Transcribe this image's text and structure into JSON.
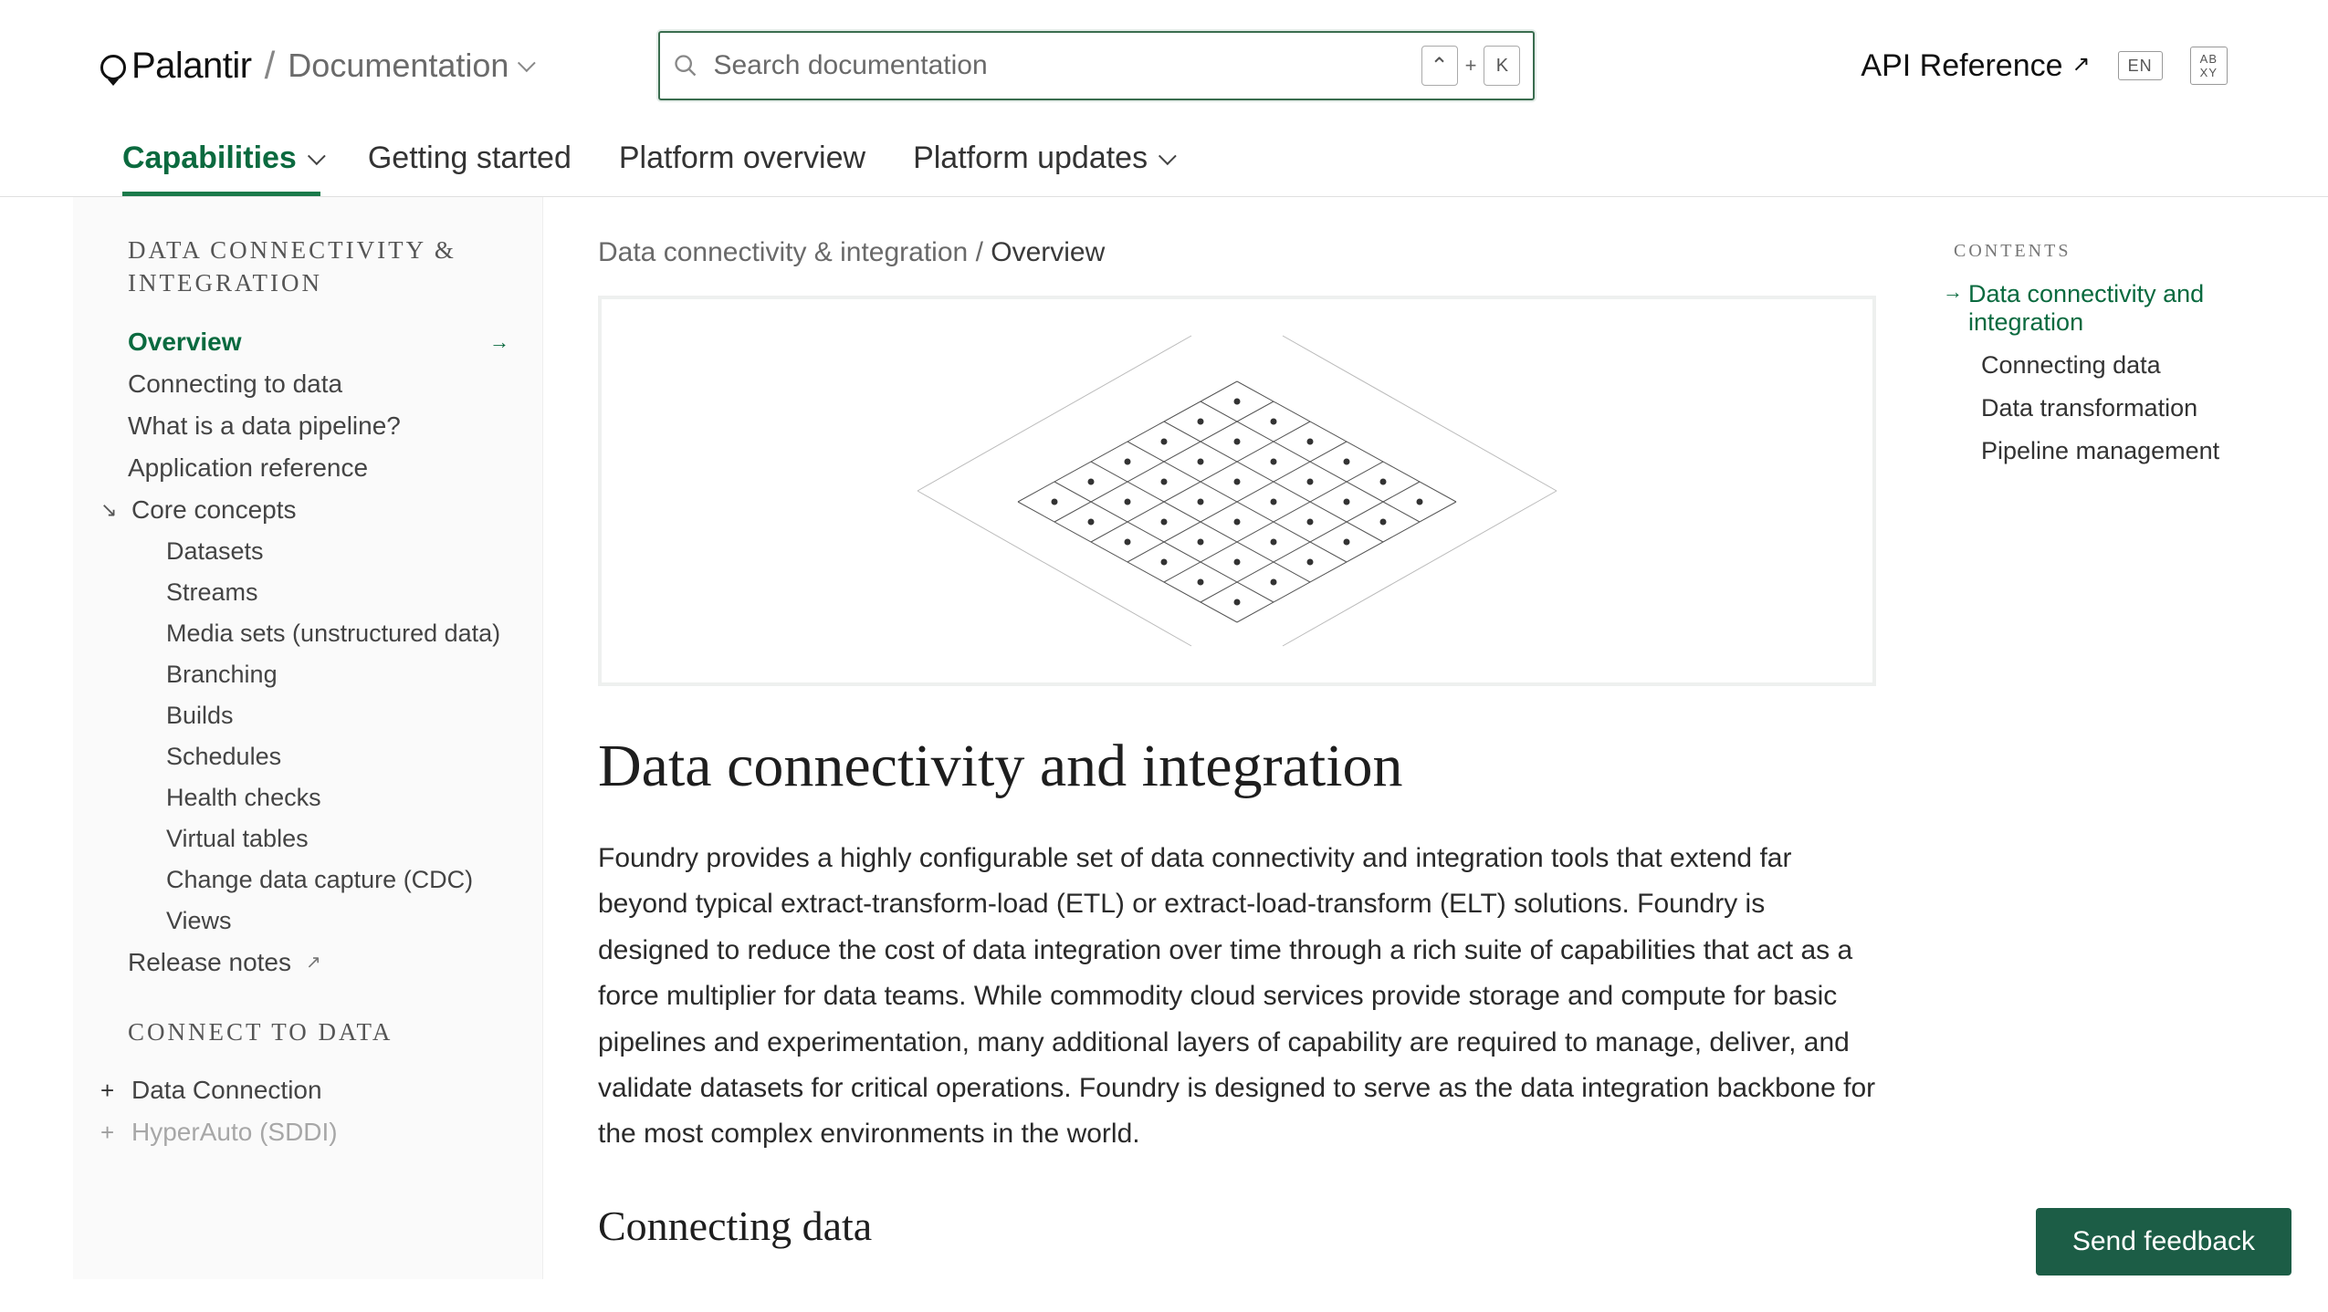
{
  "brand": "Palantir",
  "docs_label": "Documentation",
  "search": {
    "placeholder": "Search documentation",
    "kbd1": "⌃",
    "plus": "+",
    "kbd2": "K"
  },
  "api_ref": "API Reference",
  "lang_badge": "EN",
  "a11y_badge_top": "AB",
  "a11y_badge_bot": "XY",
  "nav": {
    "capabilities": "Capabilities",
    "getting_started": "Getting started",
    "platform_overview": "Platform overview",
    "platform_updates": "Platform updates"
  },
  "sidebar": {
    "section1_title": "DATA CONNECTIVITY & INTEGRATION",
    "items": [
      "Overview",
      "Connecting to data",
      "What is a data pipeline?",
      "Application reference",
      "Core concepts",
      "Datasets",
      "Streams",
      "Media sets (unstructured data)",
      "Branching",
      "Builds",
      "Schedules",
      "Health checks",
      "Virtual tables",
      "Change data capture (CDC)",
      "Views",
      "Release notes"
    ],
    "section2_title": "CONNECT TO DATA",
    "items2": [
      "Data Connection",
      "HyperAuto (SDDI)"
    ]
  },
  "crumbs": {
    "parent": "Data connectivity & integration",
    "sep": "/",
    "current": "Overview"
  },
  "article": {
    "h1": "Data connectivity and integration",
    "p1": "Foundry provides a highly configurable set of data connectivity and integration tools that extend far beyond typical extract-transform-load (ETL) or extract-load-transform (ELT) solutions. Foundry is designed to reduce the cost of data integration over time through a rich suite of capabilities that act as a force multiplier for data teams. While commodity cloud services provide storage and compute for basic pipelines and experimentation, many additional layers of capability are required to manage, deliver, and validate datasets for critical operations. Foundry is designed to serve as the data integration backbone for the most complex environments in the world.",
    "h2": "Connecting data"
  },
  "toc": {
    "title": "CONTENTS",
    "items": [
      "Data connectivity and integration",
      "Connecting data",
      "Data transformation",
      "Pipeline management"
    ]
  },
  "feedback": "Send feedback"
}
